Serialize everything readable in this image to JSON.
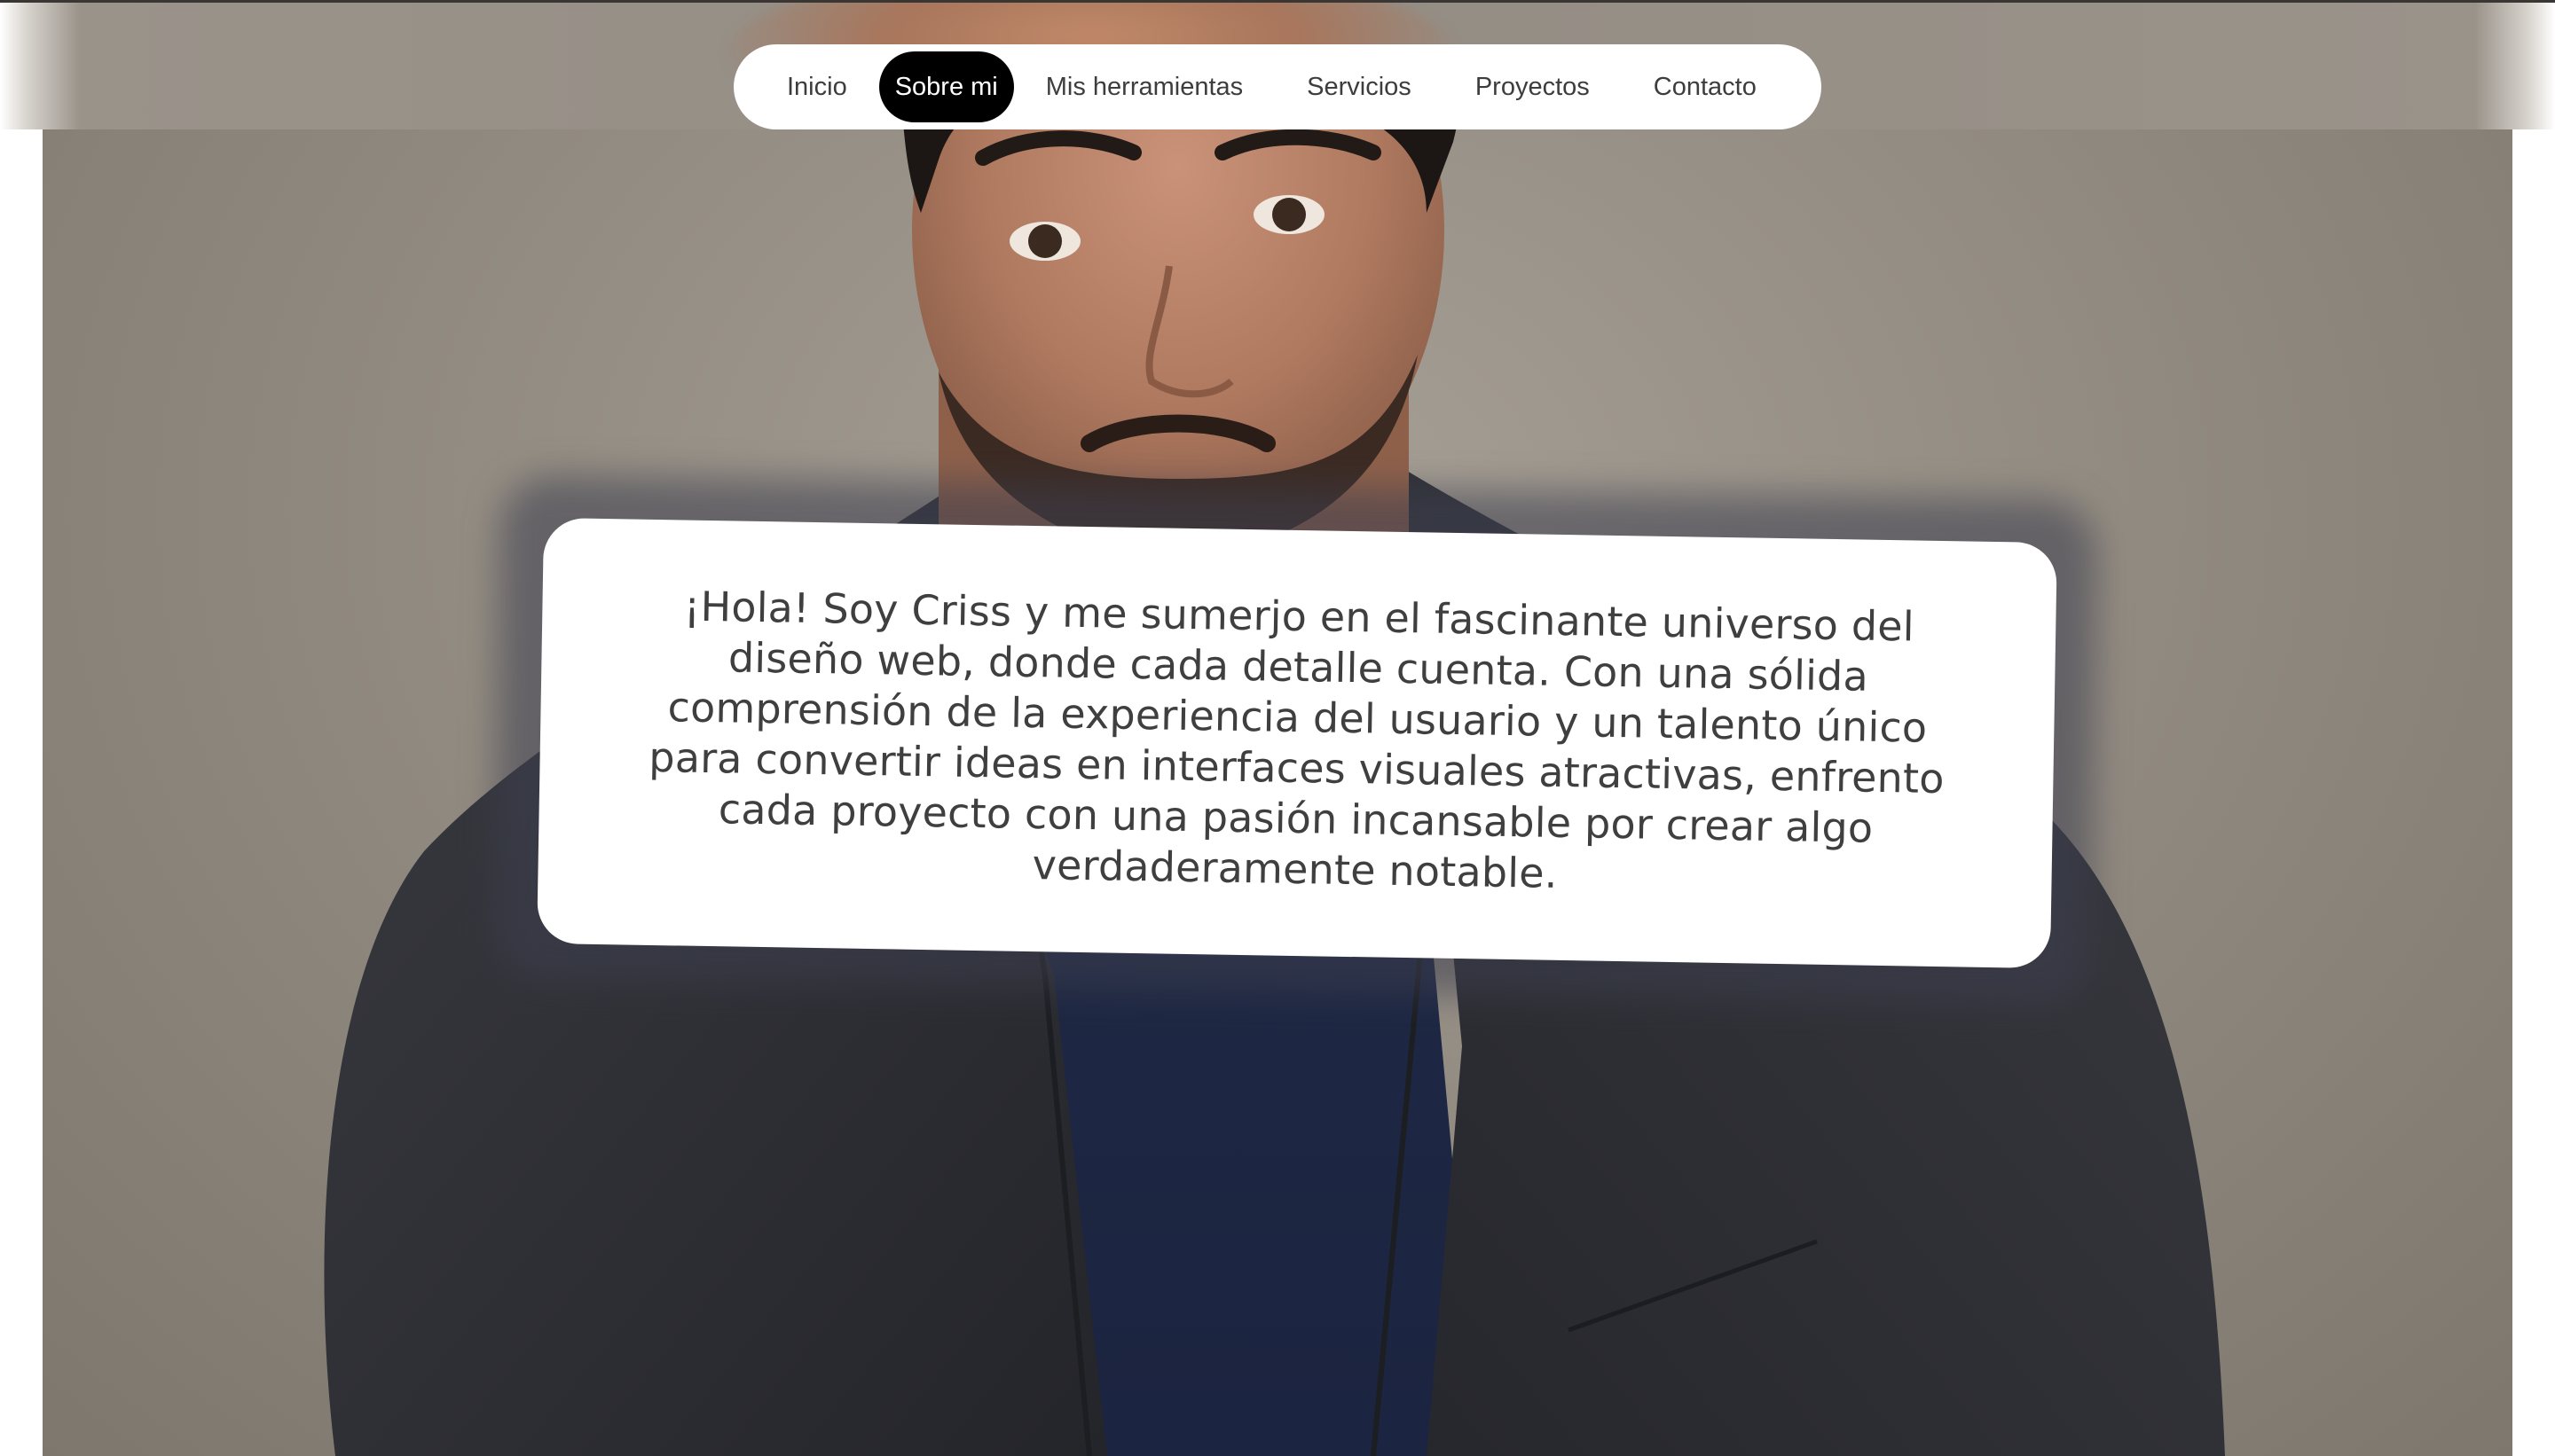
{
  "nav": {
    "items": [
      {
        "label": "Inicio",
        "active": false
      },
      {
        "label": "Sobre mi",
        "active": true
      },
      {
        "label": "Mis herramientas",
        "active": false
      },
      {
        "label": "Servicios",
        "active": false
      },
      {
        "label": "Proyectos",
        "active": false
      },
      {
        "label": "Contacto",
        "active": false
      }
    ]
  },
  "about": {
    "bio": "¡Hola! Soy Criss y me sumerjo en el fascinante universo del diseño web, donde cada detalle cuenta. Con una sólida comprensión de la experiencia del usuario y un talento único para convertir ideas en interfaces visuales atractivas, enfrento cada proyecto con una pasión incansable por crear algo verdaderamente notable."
  },
  "colors": {
    "nav_active_bg": "#000000",
    "nav_bg": "#ffffff",
    "backdrop": "#938c82",
    "jacket": "#2f3035",
    "shirt": "#1f2a44"
  }
}
